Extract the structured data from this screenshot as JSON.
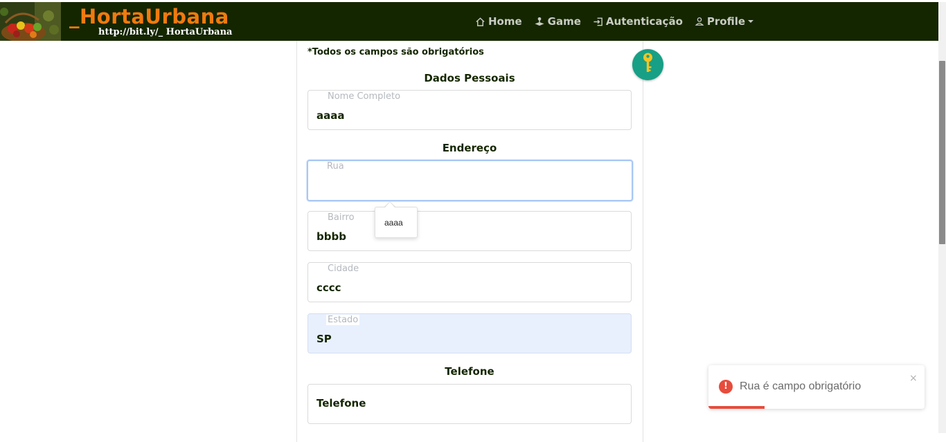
{
  "header": {
    "brand": "_HortaUrbana",
    "brand_url": "http://bit.ly/_ HortaUrbana",
    "nav": [
      {
        "label": "Home",
        "icon": "house-icon"
      },
      {
        "label": "Game",
        "icon": "joystick-icon"
      },
      {
        "label": "Autenticação",
        "icon": "login-icon"
      },
      {
        "label": "Profile",
        "icon": "user-icon"
      }
    ]
  },
  "form": {
    "required_note": "*Todos os campos são obrigatórios",
    "sections": {
      "personal": "Dados Pessoais",
      "address": "Endereço",
      "phone": "Telefone"
    },
    "fields": {
      "nome": {
        "label": "Nome Completo",
        "value": "aaaa"
      },
      "rua": {
        "label": "Rua",
        "value": ""
      },
      "bairro": {
        "label": "Bairro",
        "value": "bbbb"
      },
      "cidade": {
        "label": "Cidade",
        "value": "cccc"
      },
      "estado": {
        "label": "Estado",
        "value": "SP"
      },
      "telefone": {
        "value": "Telefone"
      }
    },
    "autocomplete_suggestion": "aaaa"
  },
  "toast": {
    "message": "Rua é campo obrigatório",
    "close": "×",
    "icon": "!",
    "progress_percent": 26,
    "accent_color": "#e74c3c"
  },
  "colors": {
    "navbar_bg": "#142600",
    "brand": "#f07a0f",
    "key_button": "#17a085"
  }
}
